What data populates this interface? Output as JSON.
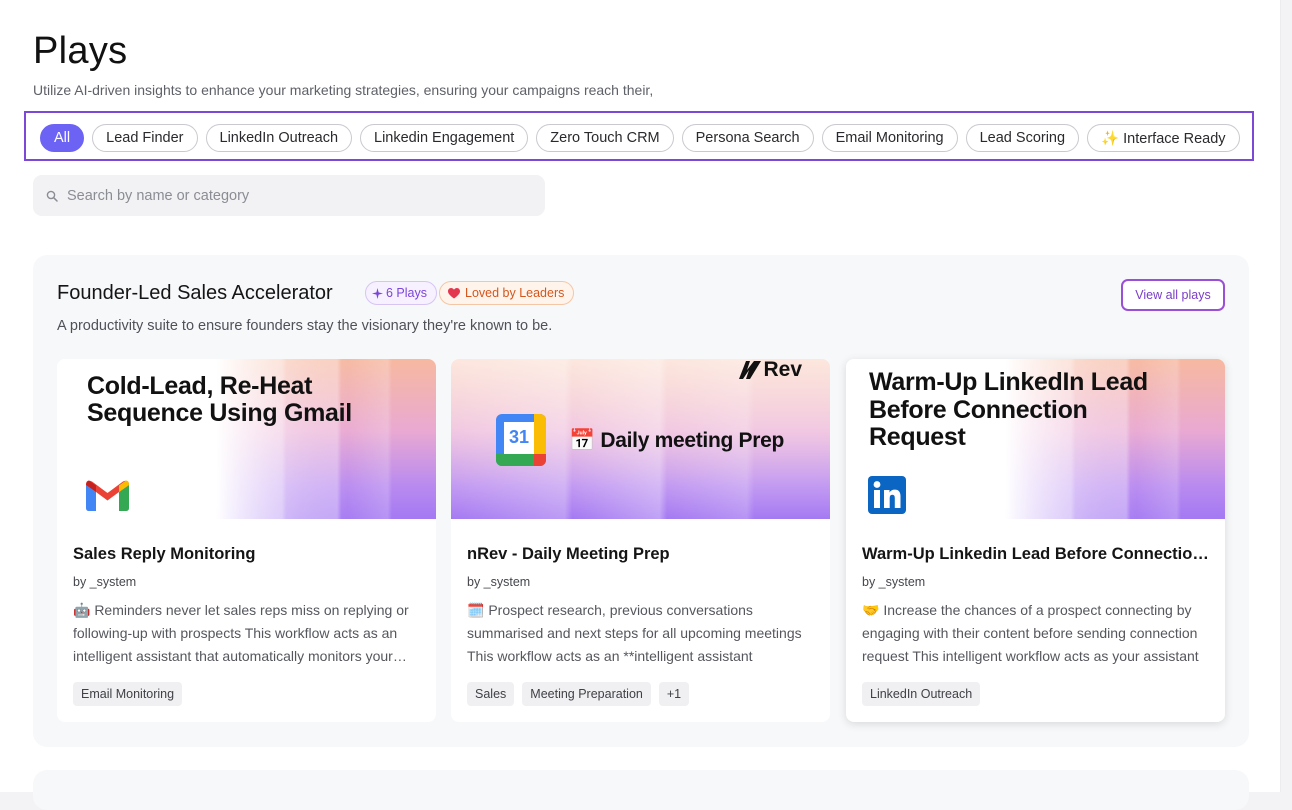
{
  "page": {
    "title": "Plays",
    "subtitle": "Utilize AI-driven insights to enhance your marketing strategies, ensuring your campaigns reach their,"
  },
  "filters": {
    "chips": [
      "All",
      "Lead Finder",
      "LinkedIn Outreach",
      "Linkedin Engagement",
      "Zero Touch CRM",
      "Persona Search",
      "Email Monitoring",
      "Lead Scoring",
      "✨ Interface Ready"
    ],
    "active": "All"
  },
  "search": {
    "placeholder": "Search by name or category"
  },
  "section": {
    "title": "Founder-Led Sales Accelerator",
    "plays_badge": "6 Plays",
    "loved_badge": "Loved by Leaders",
    "view_all": "View all plays",
    "description": "A productivity suite to ensure founders stay the visionary they're known to be."
  },
  "cards": [
    {
      "banner_text": "Cold-Lead, Re-Heat\nSequence Using Gmail",
      "banner_icon": "gmail-logo",
      "title": "Sales Reply Monitoring",
      "author": "by _system",
      "description": "🤖 Reminders never let sales reps miss on replying or following-up with prospects This workflow acts as an intelligent assistant that automatically monitors your inbox and reminds reps",
      "tags": [
        "Email Monitoring"
      ]
    },
    {
      "banner_text": "📅 Daily meeting Prep",
      "banner_brand": "Rev",
      "banner_icon": "google-calendar-logo",
      "calendar_day": "31",
      "title": "nRev - Daily Meeting Prep",
      "author": "by _system",
      "description": "🗓️ Prospect research, previous conversations summarised and next steps for all upcoming meetings This workflow acts as an **intelligent assistant",
      "tags": [
        "Sales",
        "Meeting Preparation",
        "+1"
      ]
    },
    {
      "banner_text": "Warm-Up LinkedIn Lead\nBefore Connection\nRequest",
      "banner_icon": "linkedin-logo",
      "title": "Warm-Up Linkedin Lead Before Connection Request",
      "author": "by _system",
      "description": "🤝 Increase the chances of a prospect connecting by engaging with their content before sending connection request This intelligent workflow acts as your assistant",
      "tags": [
        "LinkedIn Outreach"
      ]
    }
  ],
  "colors": {
    "accent": "#6c63f5",
    "highlight_border": "#7e48d6",
    "view_all_border": "#9b4fd6",
    "plays_badge": "#7a46d8",
    "loved_badge": "#d4561c"
  }
}
